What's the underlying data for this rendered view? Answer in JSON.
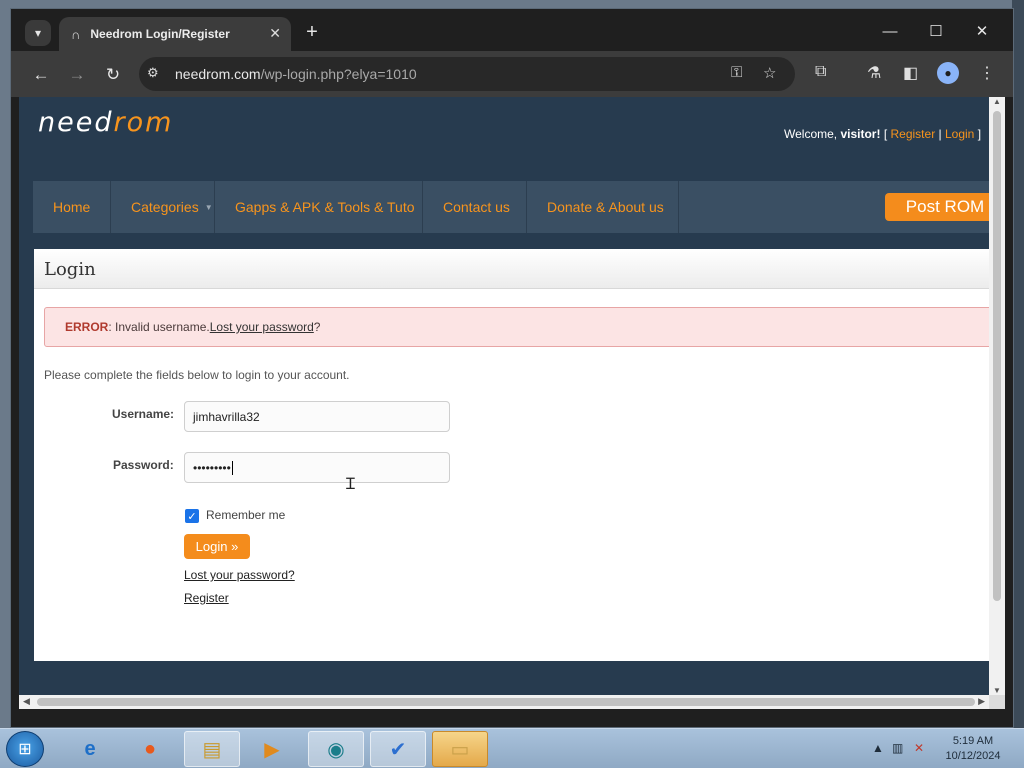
{
  "browser": {
    "tab_title": "Needrom Login/Register",
    "url_domain": "needrom.com",
    "url_path": "/wp-login.php?elya=1010"
  },
  "site": {
    "logo_part1": "need",
    "logo_part2": "rom",
    "welcome_prefix": "Welcome, ",
    "welcome_user": "visitor!",
    "register_link": "Register",
    "login_link": "Login",
    "nav": {
      "home": "Home",
      "categories": "Categories",
      "gapps": "Gapps & APK & Tools & Tuto",
      "contact": "Contact us",
      "donate": "Donate & About us"
    },
    "post_rom": "Post ROM"
  },
  "login_page": {
    "title": "Login",
    "error_label": "ERROR",
    "error_text": ": Invalid username. ",
    "error_link": "Lost your password",
    "error_end": "?",
    "intro": "Please complete the fields below to login to your account.",
    "username_label": "Username:",
    "username_value": "jimhavrilla32",
    "password_label": "Password:",
    "password_mask": "•••••••••",
    "remember_checked": true,
    "remember_label": "Remember me",
    "login_button": "Login »",
    "lost_password_link": "Lost your password?",
    "register_link": "Register"
  },
  "taskbar": {
    "time": "5:19 AM",
    "date": "10/12/2024"
  },
  "colors": {
    "accent": "#f48c1c",
    "page_bg": "#273b4f",
    "nav_bg": "#3a4f63",
    "error_bg": "#fce4e4"
  },
  "icons": [
    "tab-menu-icon",
    "tab-favicon-icon",
    "tab-close-icon",
    "new-tab-icon",
    "minimize-icon",
    "maximize-icon",
    "close-window-icon",
    "back-icon",
    "forward-icon",
    "reload-icon",
    "site-info-icon",
    "key-icon",
    "star-icon",
    "extensions-icon",
    "labs-icon",
    "sidebar-icon",
    "profile-icon",
    "menu-icon",
    "checkbox-checked-icon",
    "ibeam-cursor-icon",
    "start-icon",
    "ie-icon",
    "firefox-icon",
    "explorer-icon",
    "media-icon",
    "app-icon",
    "task-icon",
    "folder-icon",
    "network-icon",
    "volume-muted-icon"
  ]
}
